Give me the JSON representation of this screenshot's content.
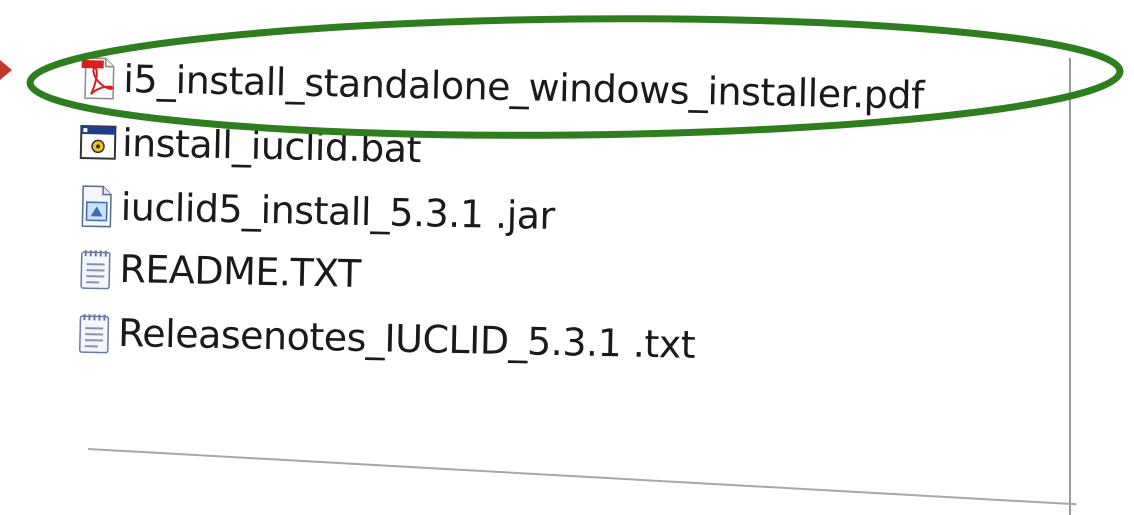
{
  "file_list": {
    "items": [
      {
        "name": "i5_install_standalone_windows_installer.pdf",
        "icon": "pdf-icon"
      },
      {
        "name": "install_iuclid.bat",
        "icon": "batch-file-icon"
      },
      {
        "name": "iuclid5_install_5.3.1 .jar",
        "icon": "jar-file-icon"
      },
      {
        "name": "README.TXT",
        "icon": "text-file-icon"
      },
      {
        "name": "Releasenotes_IUCLID_5.3.1 .txt",
        "icon": "text-file-icon"
      }
    ]
  },
  "highlight": {
    "color": "#2e7d1f",
    "target": "i5_install_standalone_windows_installer.pdf"
  }
}
